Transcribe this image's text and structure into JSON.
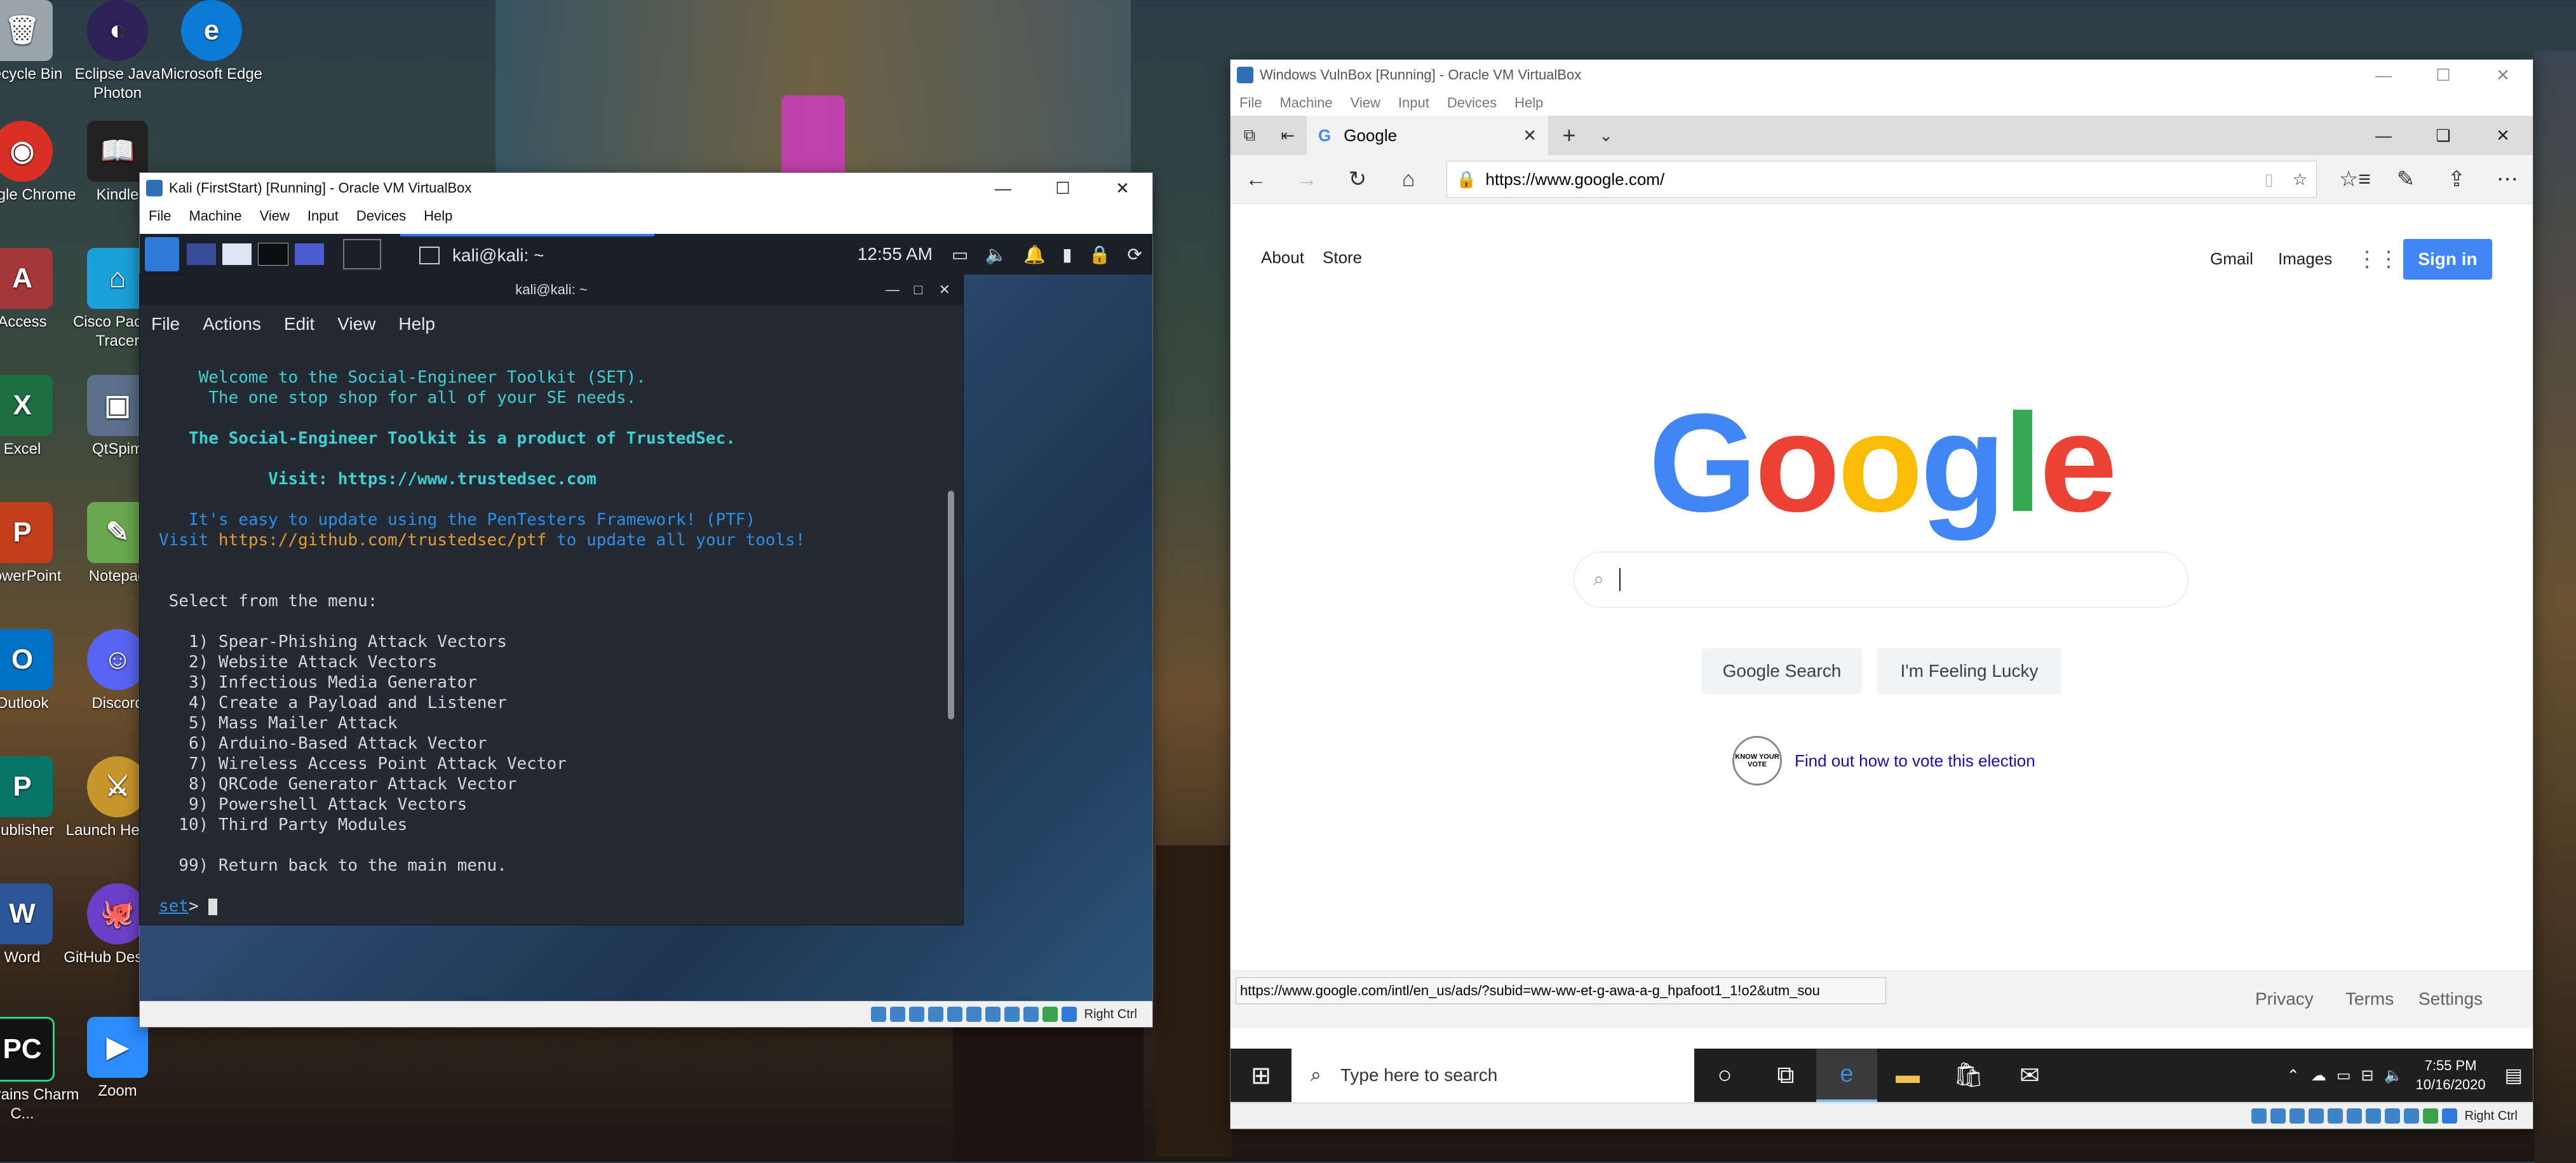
{
  "desktop": {
    "icons": [
      {
        "label": "Recycle Bin",
        "color": "#9aa4ad",
        "glyph": "🗑"
      },
      {
        "label": "Google Chrome",
        "color": "#d93025",
        "glyph": "◉"
      },
      {
        "label": "Access",
        "color": "#a4373a",
        "glyph": "A"
      },
      {
        "label": "Excel",
        "color": "#1d6f42",
        "glyph": "X"
      },
      {
        "label": "PowerPoint",
        "color": "#c43e1c",
        "glyph": "P"
      },
      {
        "label": "Outlook",
        "color": "#0072c6",
        "glyph": "O"
      },
      {
        "label": "Publisher",
        "color": "#077568",
        "glyph": "P"
      },
      {
        "label": "Word",
        "color": "#2b579a",
        "glyph": "W"
      },
      {
        "label": "JetBrains Charm C...",
        "color": "#111111",
        "glyph": "PC"
      },
      {
        "label": "Eclipse Java Photon",
        "color": "#2c2255",
        "glyph": "◐"
      },
      {
        "label": "Kindle",
        "color": "#222222",
        "glyph": "📖"
      },
      {
        "label": "Cisco Packet Tracer",
        "color": "#1ba0d7",
        "glyph": "⌂"
      },
      {
        "label": "QtSpim",
        "color": "#5a6f8a",
        "glyph": "▣"
      },
      {
        "label": "Notepad",
        "color": "#6aa84f",
        "glyph": "✎"
      },
      {
        "label": "Discord",
        "color": "#5865f2",
        "glyph": "☺"
      },
      {
        "label": "Launch Heroes",
        "color": "#c9962c",
        "glyph": "⚔"
      },
      {
        "label": "GitHub Desktop",
        "color": "#6e40c9",
        "glyph": "🐙"
      },
      {
        "label": "Zoom",
        "color": "#2d8cff",
        "glyph": "▶"
      },
      {
        "label": "Microsoft Edge",
        "color": "#0c7bd6",
        "glyph": "e"
      }
    ]
  },
  "kali_window": {
    "title": "Kali (FirstStart) [Running] - Oracle VM VirtualBox",
    "menu": [
      "File",
      "Machine",
      "View",
      "Input",
      "Devices",
      "Help"
    ],
    "panel": {
      "task_label": "kali@kali: ~",
      "clock": "12:55 AM"
    },
    "status_hostkey": "Right Ctrl",
    "terminal": {
      "title": "kali@kali: ~",
      "menu": [
        "File",
        "Actions",
        "Edit",
        "View",
        "Help"
      ],
      "lines": {
        "welcome1": "    Welcome to the Social-Engineer Toolkit (SET).",
        "welcome2": "     The one stop shop for all of your SE needs.",
        "product": "   The Social-Engineer Toolkit is a product of TrustedSec.",
        "visit": "           Visit: https://www.trustedsec.com",
        "update1": "   It's easy to update using the PenTesters Framework! (PTF)",
        "update2_prefix": "Visit ",
        "update2_url": "https://github.com/trustedsec/ptf",
        "update2_suffix": " to update all your tools!",
        "select": " Select from the menu:",
        "items": [
          "   1) Spear-Phishing Attack Vectors",
          "   2) Website Attack Vectors",
          "   3) Infectious Media Generator",
          "   4) Create a Payload and Listener",
          "   5) Mass Mailer Attack",
          "   6) Arduino-Based Attack Vector",
          "   7) Wireless Access Point Attack Vector",
          "   8) QRCode Generator Attack Vector",
          "   9) Powershell Attack Vectors",
          "  10) Third Party Modules"
        ],
        "return": "  99) Return back to the main menu.",
        "prompt": "set",
        "prompt_suffix": "> "
      }
    }
  },
  "win_window": {
    "title": "Windows VulnBox [Running] - Oracle VM VirtualBox",
    "menu": [
      "File",
      "Machine",
      "View",
      "Input",
      "Devices",
      "Help"
    ],
    "status_hostkey": "Right Ctrl",
    "edge": {
      "tab_title": "Google",
      "url": "https://www.google.com/",
      "status_url": "https://www.google.com/intl/en_us/ads/?subid=ww-ww-et-g-awa-a-g_hpafoot1_1!o2&utm_sou"
    },
    "google": {
      "top_left": [
        "About",
        "Store"
      ],
      "top_right": [
        "Gmail",
        "Images"
      ],
      "sign_in": "Sign in",
      "logo_letters": [
        {
          "ch": "G",
          "color": "#4285f4"
        },
        {
          "ch": "o",
          "color": "#ea4335"
        },
        {
          "ch": "o",
          "color": "#fbbc05"
        },
        {
          "ch": "g",
          "color": "#4285f4"
        },
        {
          "ch": "l",
          "color": "#34a853"
        },
        {
          "ch": "e",
          "color": "#ea4335"
        }
      ],
      "search_button": "Google Search",
      "lucky_button": "I'm Feeling Lucky",
      "vote_badge": "KNOW YOUR VOTE",
      "vote_link": "Find out how to vote this election",
      "footer": [
        "Privacy",
        "Terms",
        "Settings"
      ]
    },
    "taskbar": {
      "search_placeholder": "Type here to search",
      "time": "7:55 PM",
      "date": "10/16/2020"
    }
  }
}
